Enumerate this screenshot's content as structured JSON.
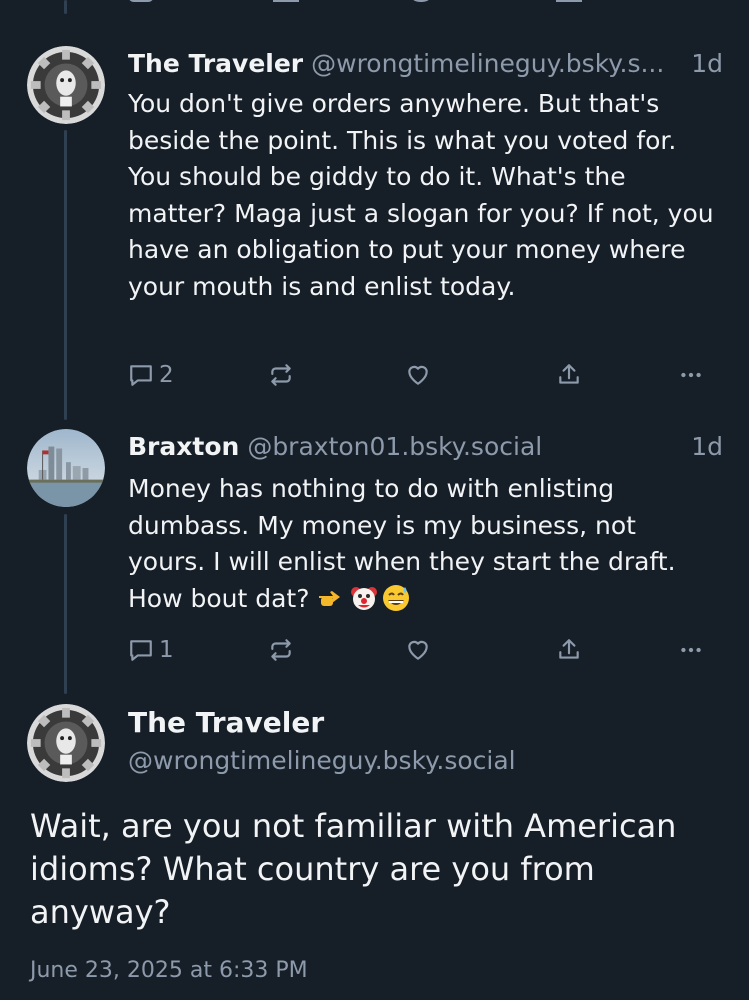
{
  "posts": [
    {
      "display_name": "The Traveler",
      "handle": "@wrongtimelineguy.bsky.s...",
      "time": "1d",
      "text": "You don't give orders anywhere. But that's beside the point. This is what you voted for. You should be giddy to do it. What's the matter? Maga just a slogan for you? If not, you have an obligation to put your money where your mouth is and enlist today.",
      "reply_count": "2",
      "avatar_icon": "gear-face-avatar"
    },
    {
      "display_name": "Braxton",
      "handle": "@braxton01.bsky.social",
      "time": "1d",
      "text": "Money has nothing to do with enlisting dumbass. My money is my business, not yours. I will enlist when they start the draft. How bout dat?",
      "emojis": [
        "pointing-right-emoji",
        "clown-face-emoji",
        "grinning-sweat-emoji"
      ],
      "reply_count": "1",
      "avatar_icon": "city-skyline-avatar"
    }
  ],
  "main_post": {
    "display_name": "The Traveler",
    "handle": "@wrongtimelineguy.bsky.social",
    "text": "Wait, are you not familiar with American idioms? What country are you from anyway?",
    "date": "June 23, 2025 at 6:33 PM",
    "avatar_icon": "gear-face-avatar"
  },
  "icons": {
    "reply": "speech-bubble-icon",
    "repost": "repost-arrows-icon",
    "like": "heart-icon",
    "share": "share-icon",
    "more": "more-dots-icon"
  },
  "colors": {
    "background": "#161e27",
    "text": "#f1f3f5",
    "muted": "#8d9aab",
    "thread_line": "#2e4052"
  }
}
